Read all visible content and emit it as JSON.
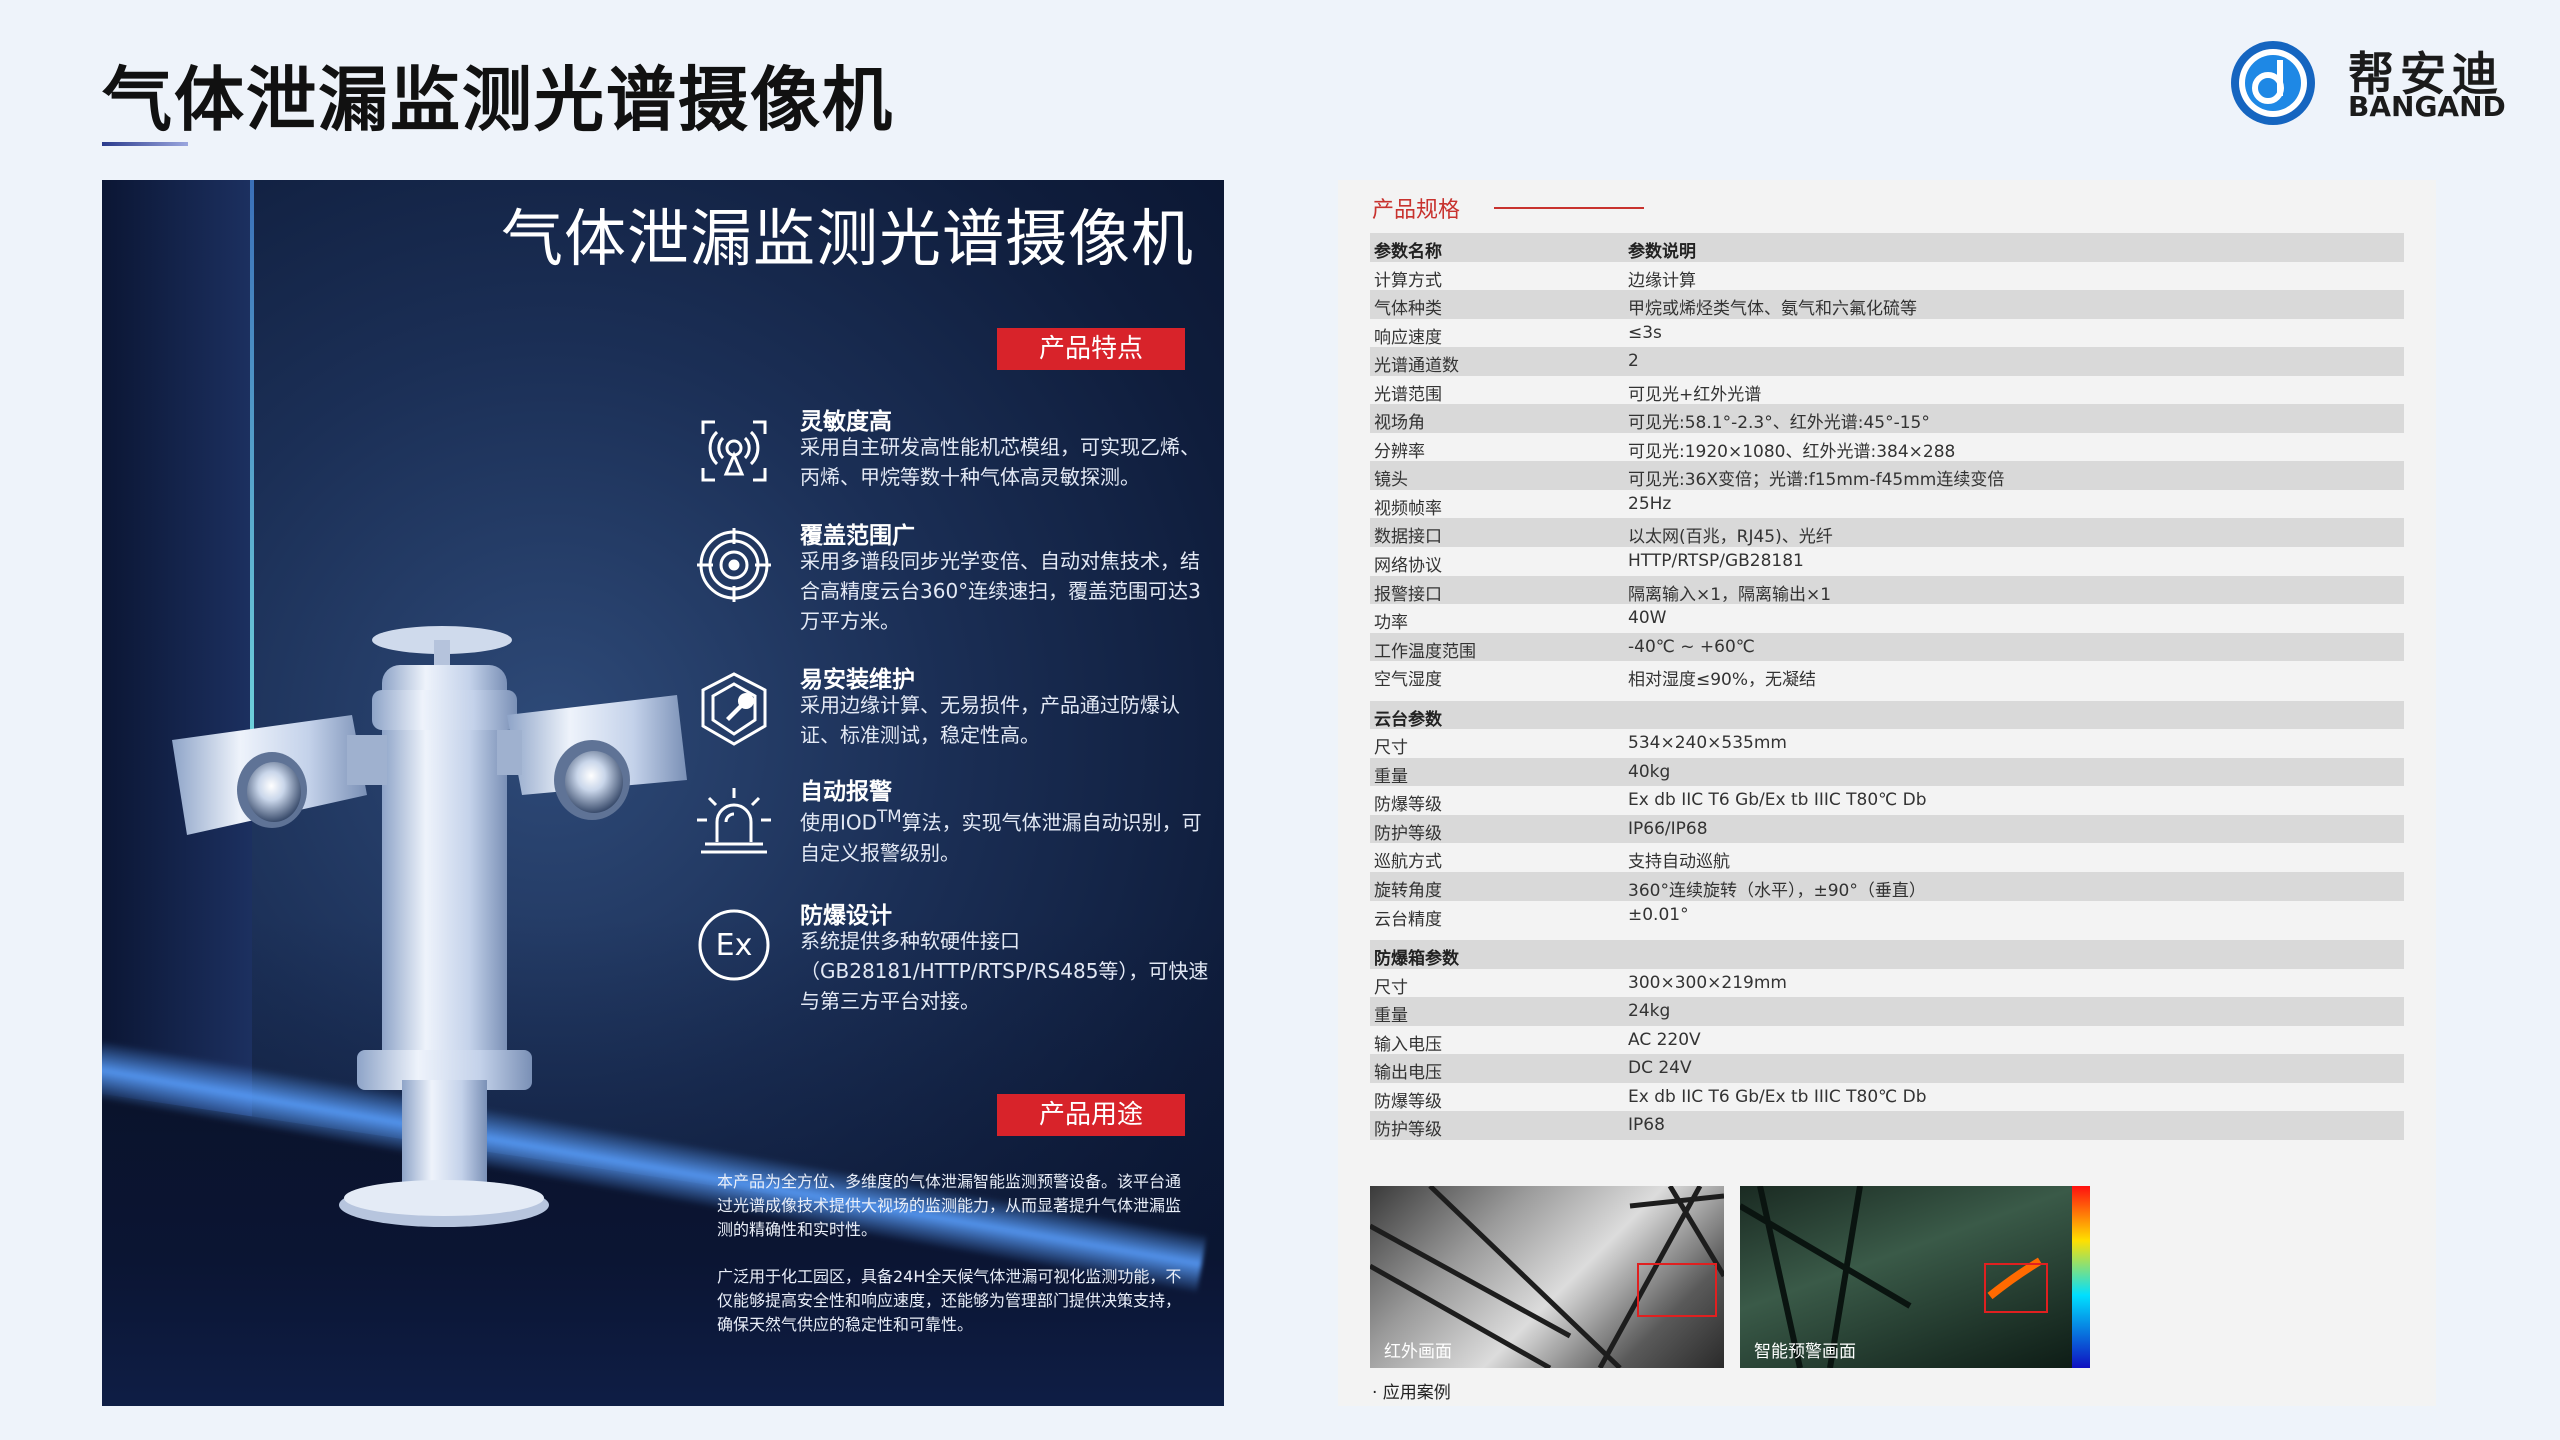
{
  "header": {
    "title": "气体泄漏监测光谱摄像机",
    "logo_cn": "帮安迪",
    "logo_en": "BANGAND"
  },
  "poster": {
    "title": "气体泄漏监测光谱摄像机",
    "features_tag": "产品特点",
    "usage_tag": "产品用途",
    "features": [
      {
        "icon": "gas-sensor-icon",
        "title": "灵敏度高",
        "desc": "采用自主研发高性能机芯模组，可实现乙烯、丙烯、甲烷等数十种气体高灵敏探测。"
      },
      {
        "icon": "target-icon",
        "title": "覆盖范围广",
        "desc": "采用多谱段同步光学变倍、自动对焦技术，结合高精度云台360°连续速扫，覆盖范围可达3万平方米。"
      },
      {
        "icon": "wrench-shield-icon",
        "title": "易安装维护",
        "desc": "采用边缘计算、无易损件，产品通过防爆认证、标准测试，稳定性高。"
      },
      {
        "icon": "alarm-light-icon",
        "title": "自动报警",
        "desc_pre": "使用IOD",
        "desc_sup": "TM",
        "desc_post": "算法，实现气体泄漏自动识别，可自定义报警级别。"
      },
      {
        "icon": "ex-icon",
        "title": "防爆设计",
        "desc": "系统提供多种软硬件接口（GB28181/HTTP/RTSP/RS485等），可快速与第三方平台对接。"
      }
    ],
    "usage": [
      "本产品为全方位、多维度的气体泄漏智能监测预警设备。该平台通过光谱成像技术提供大视场的监测能力，从而显著提升气体泄漏监测的精确性和实时性。",
      "广泛用于化工园区，具备24H全天候气体泄漏可视化监测功能，不仅能够提高安全性和响应速度，还能够为管理部门提供决策支持，确保天然气供应的稳定性和可靠性。"
    ]
  },
  "spec": {
    "heading": "产品规格",
    "sections": [
      {
        "rows": [
          [
            "参数名称",
            "参数说明"
          ],
          [
            "计算方式",
            "边缘计算"
          ],
          [
            "气体种类",
            "甲烷或烯烃类气体、氨气和六氟化硫等"
          ],
          [
            "响应速度",
            "≤3s"
          ],
          [
            "光谱通道数",
            "2"
          ],
          [
            "光谱范围",
            "可见光+红外光谱"
          ],
          [
            "视场角",
            "可见光:58.1°-2.3°、红外光谱:45°-15°"
          ],
          [
            "分辨率",
            "可见光:1920×1080、红外光谱:384×288"
          ],
          [
            "镜头",
            "可见光:36X变倍；光谱:f15mm-f45mm连续变倍"
          ],
          [
            "视频帧率",
            "25Hz"
          ],
          [
            "数据接口",
            "以太网(百兆，RJ45)、光纤"
          ],
          [
            "网络协议",
            "HTTP/RTSP/GB28181"
          ],
          [
            "报警接口",
            "隔离输入×1，隔离输出×1"
          ],
          [
            "功率",
            "40W"
          ],
          [
            "工作温度范围",
            "-40℃ ~ +60℃"
          ],
          [
            "空气湿度",
            "相对湿度≤90%，无凝结"
          ]
        ]
      },
      {
        "rows": [
          [
            "云台参数",
            ""
          ],
          [
            "尺寸",
            "534×240×535mm"
          ],
          [
            "重量",
            "40kg"
          ],
          [
            "防爆等级",
            "Ex db IIC T6 Gb/Ex tb IIIC  T80℃ Db"
          ],
          [
            "防护等级",
            "IP66/IP68"
          ],
          [
            "巡航方式",
            "支持自动巡航"
          ],
          [
            "旋转角度",
            "360°连续旋转（水平），±90°（垂直）"
          ],
          [
            "云台精度",
            "±0.01°"
          ]
        ]
      },
      {
        "rows": [
          [
            "防爆箱参数",
            ""
          ],
          [
            "尺寸",
            "300×300×219mm"
          ],
          [
            "重量",
            "24kg"
          ],
          [
            "输入电压",
            "AC 220V"
          ],
          [
            "输出电压",
            "DC 24V"
          ],
          [
            "防爆等级",
            "Ex db IIC T6 Gb/Ex tb IIIC  T80℃ Db"
          ],
          [
            "防护等级",
            "IP68"
          ]
        ]
      }
    ],
    "photo_ir": "红外画面",
    "photo_alarm": "智能预警画面",
    "case_label": "· 应用案例"
  }
}
